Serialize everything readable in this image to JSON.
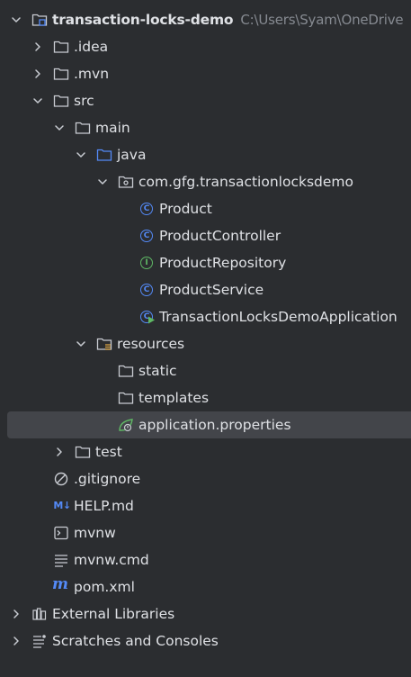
{
  "project": {
    "name": "transaction-locks-demo",
    "path": "C:\\Users\\Syam\\OneDrive"
  },
  "nodes": {
    "idea": ".idea",
    "mvn": ".mvn",
    "src": "src",
    "main": "main",
    "java": "java",
    "package": "com.gfg.transactionlocksdemo",
    "product": "Product",
    "product_controller": "ProductController",
    "product_repository": "ProductRepository",
    "product_service": "ProductService",
    "application": "TransactionLocksDemoApplication",
    "resources": "resources",
    "static": "static",
    "templates": "templates",
    "application_properties": "application.properties",
    "test": "test",
    "gitignore": ".gitignore",
    "help_md": "HELP.md",
    "mvnw": "mvnw",
    "mvnw_cmd": "mvnw.cmd",
    "pom": "pom.xml",
    "external_libraries": "External Libraries",
    "scratches": "Scratches and Consoles"
  },
  "icon_glyphs": {
    "class": "C",
    "interface": "I",
    "markdown": "M↓",
    "maven": "m"
  },
  "icons": {
    "chevron": "chevron-icon",
    "folder": "folder-icon",
    "source_folder": "source-folder-icon",
    "resources_folder": "resources-folder-icon",
    "package": "package-icon",
    "class": "class-icon",
    "interface": "interface-icon",
    "spring_boot_class": "spring-boot-class-icon",
    "spring_properties": "spring-properties-icon",
    "gitignore": "ignore-file-icon",
    "markdown": "markdown-icon",
    "terminal": "shell-script-icon",
    "text": "text-file-icon",
    "maven": "maven-icon",
    "libraries": "libraries-icon",
    "scratches": "scratches-icon"
  },
  "colors": {
    "background": "#2b2d30",
    "text": "#dfe1e5",
    "secondary_text": "#868a91",
    "selection": "#43454a",
    "class_blue": "#548af7",
    "interface_green": "#5fb865",
    "spring_green": "#5fb865",
    "source_folder_blue": "#548af7",
    "resources_yellow": "#d9a343"
  },
  "selected_node": "application.properties"
}
